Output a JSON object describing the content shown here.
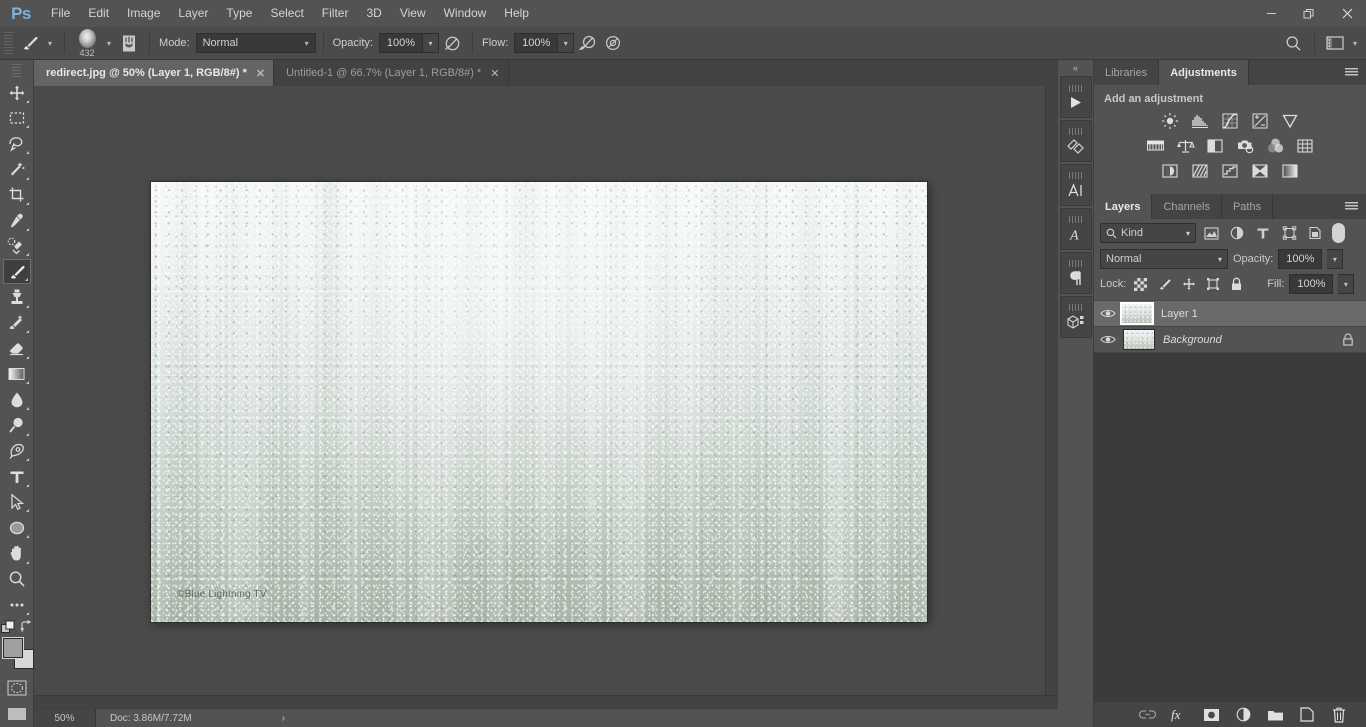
{
  "app": {
    "name": "Ps",
    "logo_color": "#7fb3d8"
  },
  "menubar": {
    "items": [
      "File",
      "Edit",
      "Image",
      "Layer",
      "Type",
      "Select",
      "Filter",
      "3D",
      "View",
      "Window",
      "Help"
    ]
  },
  "window_controls": {
    "minimize": "–",
    "restore": "❐",
    "close": "✕"
  },
  "options_bar": {
    "tool_icon": "brush-icon",
    "brush_size": "432",
    "mode_label": "Mode:",
    "mode_value": "Normal",
    "opacity_label": "Opacity:",
    "opacity_value": "100%",
    "flow_label": "Flow:",
    "flow_value": "100%",
    "search_icon": "search-icon",
    "workspace_icon": "workspace-icon"
  },
  "tabs": [
    {
      "label": "redirect.jpg @ 50% (Layer 1, RGB/8#) *",
      "close": "✕",
      "active": true
    },
    {
      "label": "Untitled-1 @ 66.7% (Layer 1, RGB/8#) *",
      "close": "✕",
      "active": false
    }
  ],
  "tools": [
    {
      "name": "move-tool",
      "active": false
    },
    {
      "name": "rectangular-marquee-tool",
      "active": false
    },
    {
      "name": "lasso-tool",
      "active": false
    },
    {
      "name": "magic-wand-tool",
      "active": false
    },
    {
      "name": "crop-tool",
      "active": false
    },
    {
      "name": "eyedropper-tool",
      "active": false
    },
    {
      "name": "spot-healing-brush-tool",
      "active": false
    },
    {
      "name": "brush-tool",
      "active": true
    },
    {
      "name": "clone-stamp-tool",
      "active": false
    },
    {
      "name": "history-brush-tool",
      "active": false
    },
    {
      "name": "eraser-tool",
      "active": false
    },
    {
      "name": "gradient-tool",
      "active": false
    },
    {
      "name": "blur-tool",
      "active": false
    },
    {
      "name": "dodge-tool",
      "active": false
    },
    {
      "name": "pen-tool",
      "active": false
    },
    {
      "name": "type-tool",
      "active": false
    },
    {
      "name": "path-selection-tool",
      "active": false
    },
    {
      "name": "ellipse-shape-tool",
      "active": false
    },
    {
      "name": "hand-tool",
      "active": false
    },
    {
      "name": "zoom-tool",
      "active": false
    },
    {
      "name": "edit-toolbar-tool",
      "active": false
    }
  ],
  "canvas": {
    "watermark": "©Blue Lightning TV",
    "image_description": "condensation water droplets on glass"
  },
  "statusbar": {
    "zoom": "50%",
    "doc": "Doc: 3.86M/7.72M",
    "expand_arrow": "›"
  },
  "dock_strip": {
    "collapse_icon": "double-chevron-left-icon",
    "buttons": [
      {
        "name": "timeline-play-icon"
      },
      {
        "name": "brush-presets-icon"
      },
      {
        "name": "character-panel-icon"
      },
      {
        "name": "glyphs-panel-icon"
      },
      {
        "name": "paragraph-panel-icon"
      },
      {
        "name": "3d-panel-icon"
      }
    ]
  },
  "adjustments_panel": {
    "tabs": [
      {
        "label": "Libraries",
        "active": false
      },
      {
        "label": "Adjustments",
        "active": true
      }
    ],
    "heading": "Add an adjustment",
    "icons": [
      [
        "brightness-contrast-icon",
        "levels-icon",
        "curves-icon",
        "exposure-icon",
        "vibrance-icon"
      ],
      [
        "hue-saturation-icon",
        "color-balance-icon",
        "black-white-icon",
        "photo-filter-icon",
        "channel-mixer-icon",
        "color-lookup-icon"
      ],
      [
        "invert-icon",
        "posterize-icon",
        "threshold-icon",
        "selective-color-icon",
        "gradient-map-icon"
      ]
    ]
  },
  "layers_panel": {
    "tabs": [
      {
        "label": "Layers",
        "active": true
      },
      {
        "label": "Channels",
        "active": false
      },
      {
        "label": "Paths",
        "active": false
      }
    ],
    "filter": {
      "kind_label": "Kind",
      "search_icon": "search-icon",
      "icons": [
        "pixel-filter-icon",
        "adjustment-filter-icon",
        "type-filter-icon",
        "shape-filter-icon",
        "smart-object-filter-icon"
      ],
      "toggle": "filter-toggle"
    },
    "blend_mode": "Normal",
    "opacity_label": "Opacity:",
    "opacity_value": "100%",
    "lock_label": "Lock:",
    "lock_icons": [
      "lock-transparent-pixels-icon",
      "lock-image-pixels-icon",
      "lock-position-icon",
      "lock-artboard-icon",
      "lock-all-icon"
    ],
    "fill_label": "Fill:",
    "fill_value": "100%",
    "layers": [
      {
        "name": "Layer 1",
        "visible": true,
        "selected": true,
        "locked": false,
        "italic": false
      },
      {
        "name": "Background",
        "visible": true,
        "selected": false,
        "locked": true,
        "italic": true
      }
    ],
    "footer_icons": [
      "link-layers-icon",
      "layer-style-fx-icon",
      "add-layer-mask-icon",
      "new-adjustment-layer-icon",
      "new-group-icon",
      "new-layer-icon",
      "delete-layer-icon"
    ]
  }
}
